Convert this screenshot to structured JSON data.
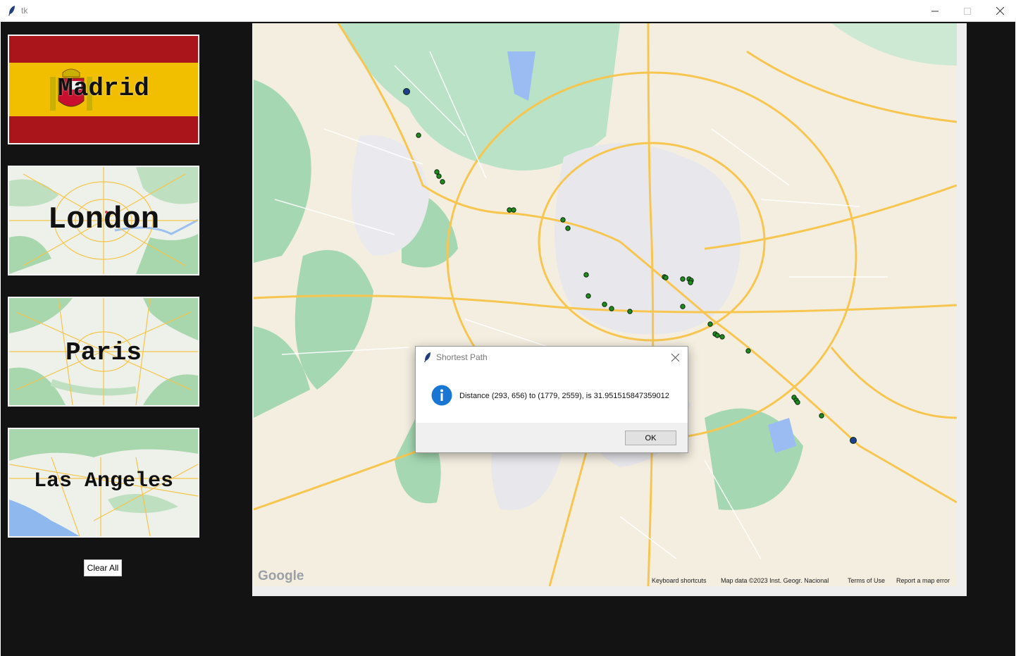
{
  "window": {
    "title": "tk"
  },
  "sidebar": {
    "cities": [
      {
        "label": "Madrid"
      },
      {
        "label": "London"
      },
      {
        "label": "Paris"
      },
      {
        "label": "Las Angeles"
      }
    ],
    "clear_label": "Clear All"
  },
  "map": {
    "logo": "Google",
    "attribution": {
      "shortcuts": "Keyboard shortcuts",
      "data": "Map data ©2023 Inst. Geogr. Nacional",
      "terms": "Terms of Use",
      "report": "Report a map error"
    }
  },
  "dialog": {
    "title": "Shortest Path",
    "message": "Distance (293, 656) to (1779, 2559), is 31.951515847359012",
    "ok_label": "OK",
    "icon": "info-icon"
  },
  "colors": {
    "path_node": "#1f8a1f",
    "endpoint": "#1d3f8f",
    "spain_red": "#aa151b",
    "spain_yellow": "#f1bf00"
  }
}
